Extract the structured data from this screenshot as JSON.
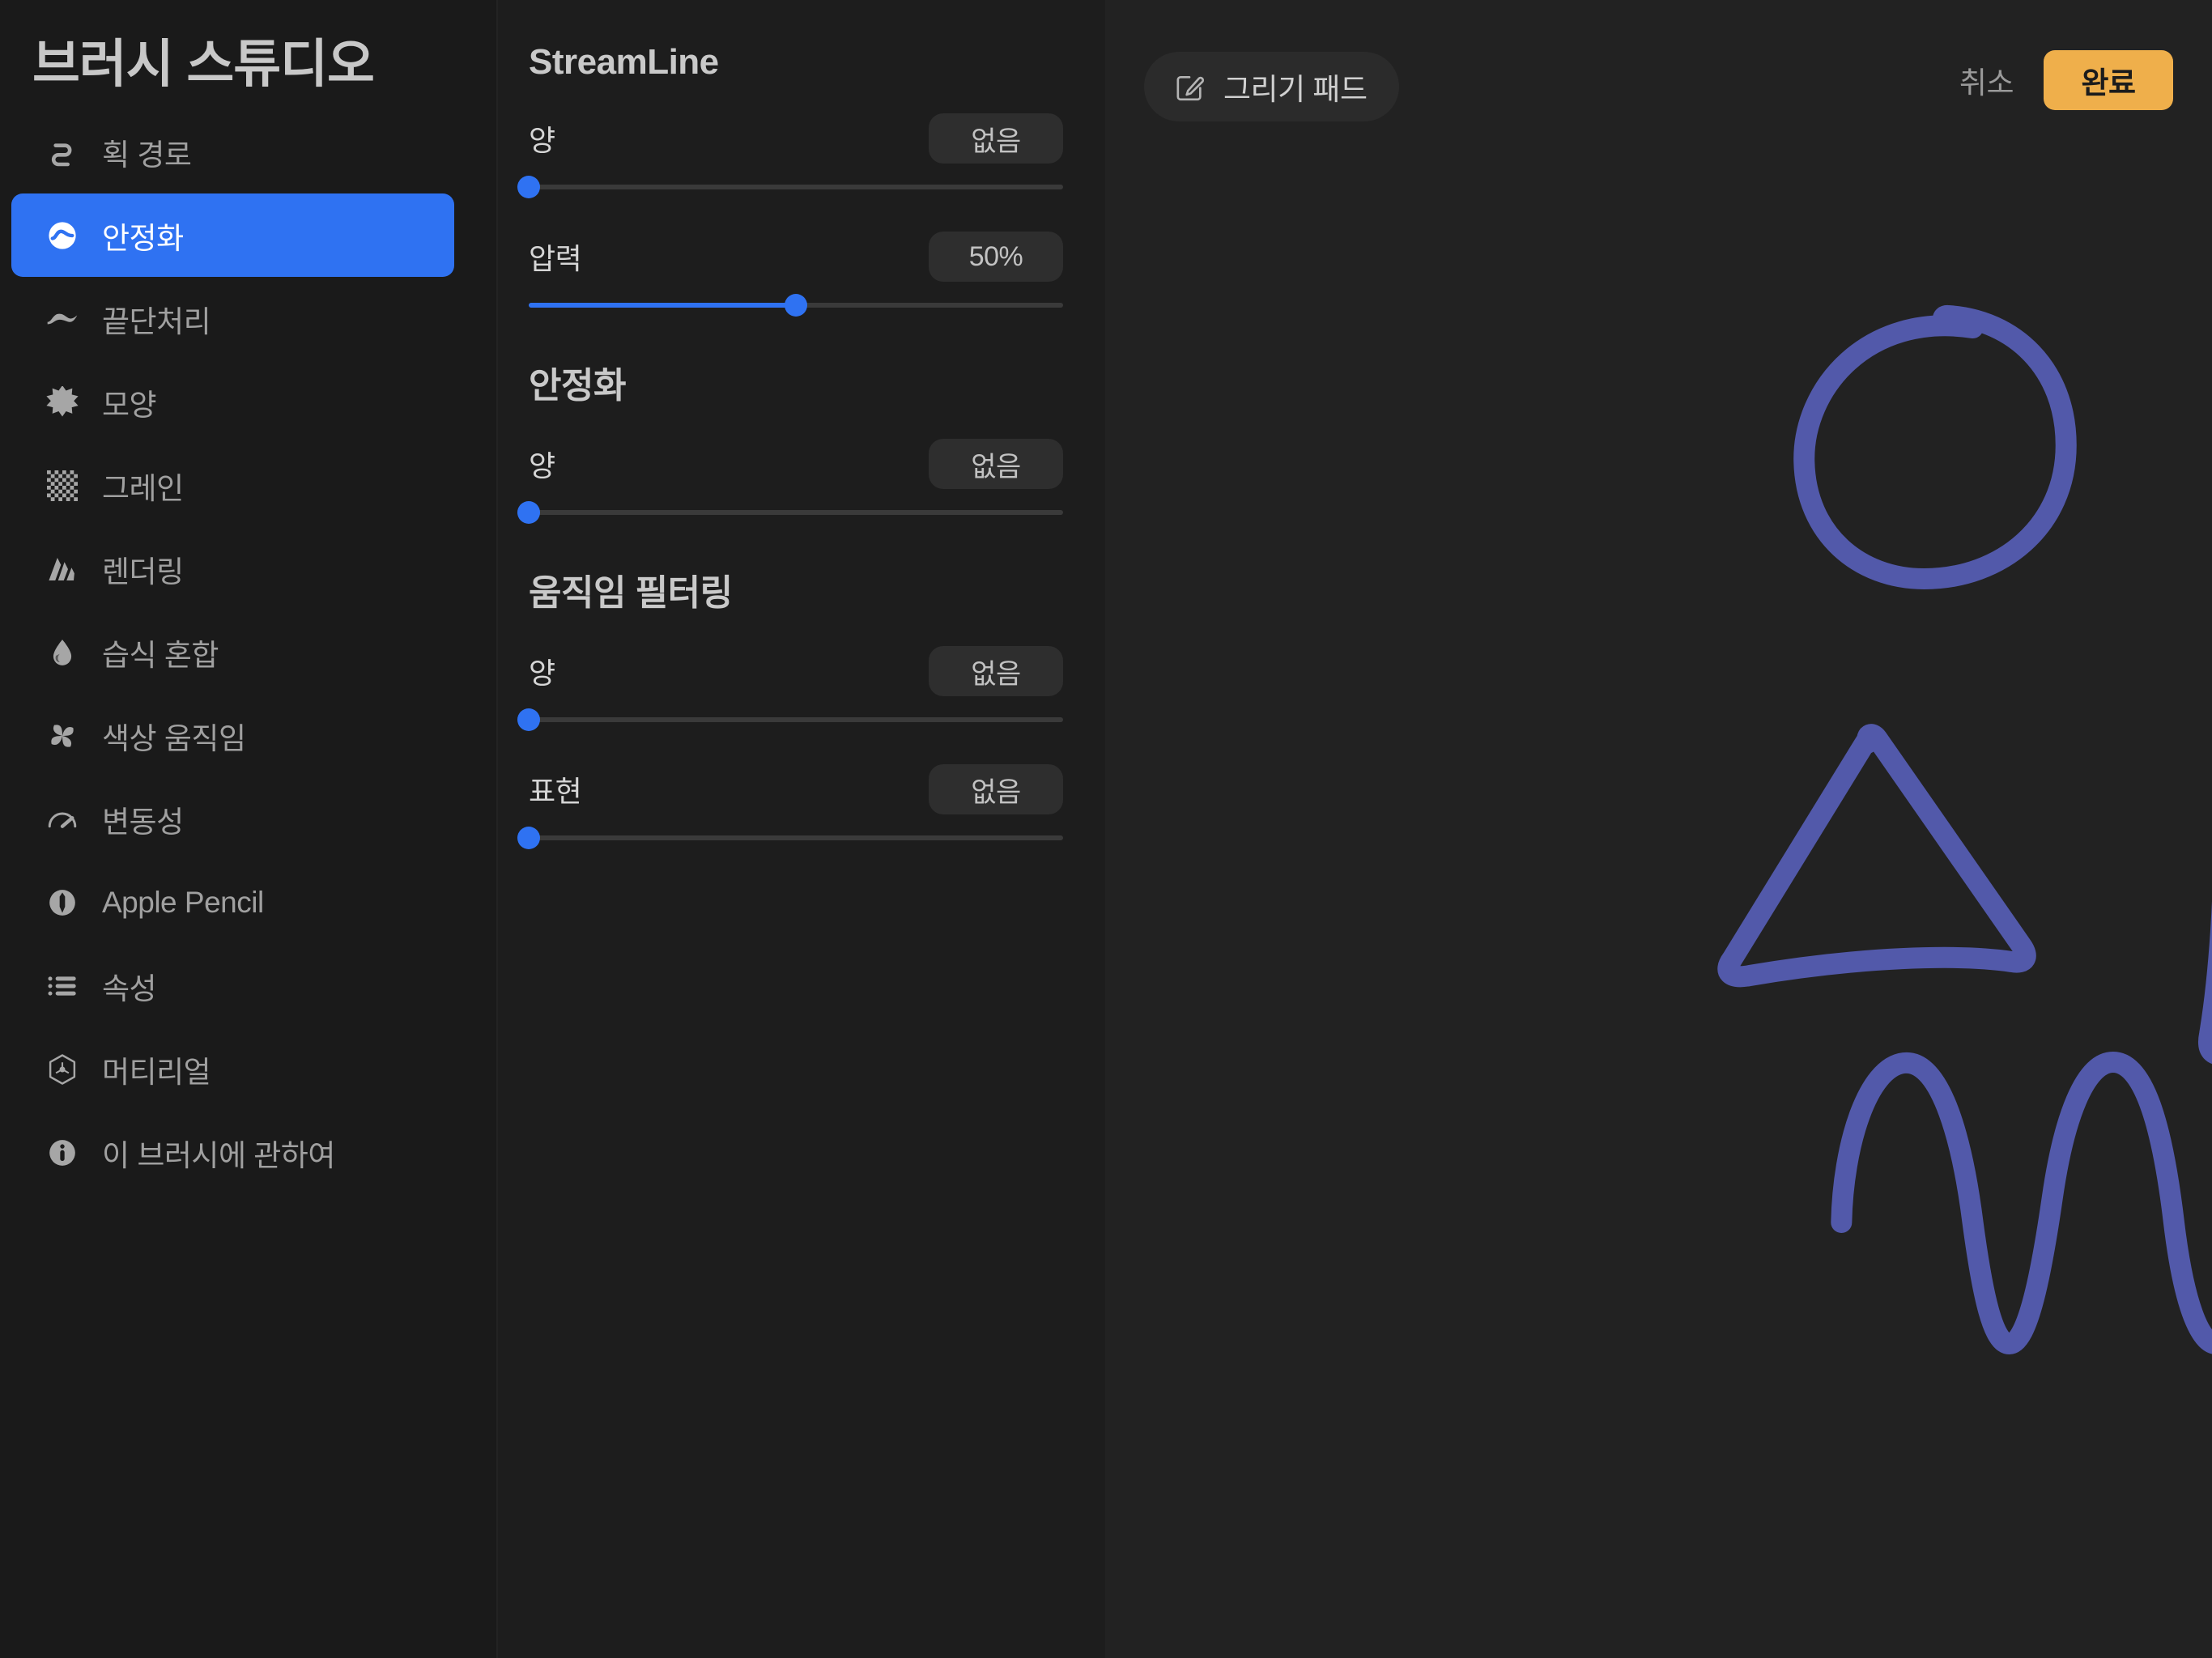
{
  "app": {
    "title": "브러시 스튜디오",
    "accent_blue": "#2f72f2",
    "accent_orange": "#efaf4b",
    "stroke_color": "#5259aa",
    "panel_bg": "#1a1a1a",
    "canvas_bg": "#222222"
  },
  "sidebar": {
    "items": [
      {
        "label": "획 경로",
        "icon": "stroke-path-icon",
        "active": false
      },
      {
        "label": "안정화",
        "icon": "stabilization-icon",
        "active": true
      },
      {
        "label": "끝단처리",
        "icon": "taper-icon",
        "active": false
      },
      {
        "label": "모양",
        "icon": "shape-icon",
        "active": false
      },
      {
        "label": "그레인",
        "icon": "grain-icon",
        "active": false
      },
      {
        "label": "렌더링",
        "icon": "rendering-icon",
        "active": false
      },
      {
        "label": "습식 혼합",
        "icon": "wet-mix-icon",
        "active": false
      },
      {
        "label": "색상 움직임",
        "icon": "color-dynamics-icon",
        "active": false
      },
      {
        "label": "변동성",
        "icon": "variability-icon",
        "active": false
      },
      {
        "label": "Apple Pencil",
        "icon": "apple-pencil-icon",
        "active": false
      },
      {
        "label": "속성",
        "icon": "properties-icon",
        "active": false
      },
      {
        "label": "머티리얼",
        "icon": "material-icon",
        "active": false
      },
      {
        "label": "이 브러시에 관하여",
        "icon": "about-info-icon",
        "active": false
      }
    ]
  },
  "settings": {
    "sections": [
      {
        "title": "StreamLine",
        "rows": [
          {
            "label": "양",
            "value": "없음",
            "percent": 0
          },
          {
            "label": "압력",
            "value": "50%",
            "percent": 50
          }
        ]
      },
      {
        "title": "안정화",
        "rows": [
          {
            "label": "양",
            "value": "없음",
            "percent": 0
          }
        ]
      },
      {
        "title": "움직임 필터링",
        "rows": [
          {
            "label": "양",
            "value": "없음",
            "percent": 0
          },
          {
            "label": "표현",
            "value": "없음",
            "percent": 0
          }
        ]
      }
    ]
  },
  "canvas": {
    "draw_pad_label": "그리기 패드",
    "draw_pad_icon": "pencil-square-icon",
    "cancel_label": "취소",
    "done_label": "완료",
    "strokes": [
      {
        "name": "circle-stroke",
        "shape": "circle"
      },
      {
        "name": "triangle-stroke",
        "shape": "triangle"
      },
      {
        "name": "square-stroke",
        "shape": "square"
      },
      {
        "name": "wave-stroke",
        "shape": "wave"
      }
    ]
  }
}
